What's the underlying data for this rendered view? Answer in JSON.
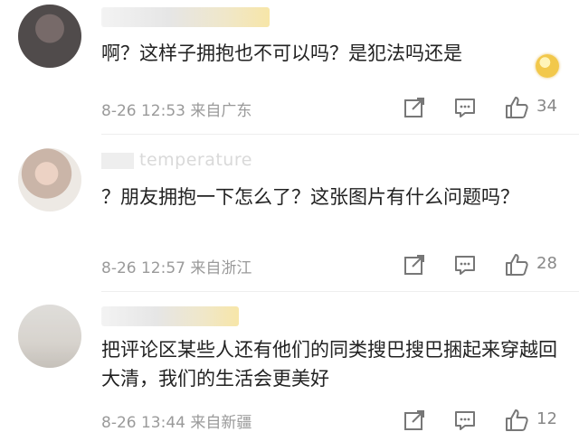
{
  "comments": [
    {
      "text": "啊？这样子拥抱也不可以吗？是犯法吗还是",
      "timestamp": "8-26 12:53",
      "location": "来自广东",
      "likes": "34"
    },
    {
      "username": "temperature",
      "text": "？朋友拥抱一下怎么了？这张图片有什么问题吗？",
      "timestamp": "8-26 12:57",
      "location": "来自浙江",
      "likes": "28"
    },
    {
      "text": "把评论区某些人还有他们的同类搜巴搜巴捆起来穿越回大清，我们的生活会更美好",
      "timestamp": "8-26 13:44",
      "location": "来自新疆",
      "likes": "12"
    }
  ],
  "icons": {
    "share": "share-icon",
    "comment": "comment-icon",
    "like": "thumbs-up-icon",
    "badge": "gold-badge-icon"
  },
  "colors": {
    "text": "#222222",
    "meta": "#9a9a9a",
    "icon": "#777777"
  }
}
